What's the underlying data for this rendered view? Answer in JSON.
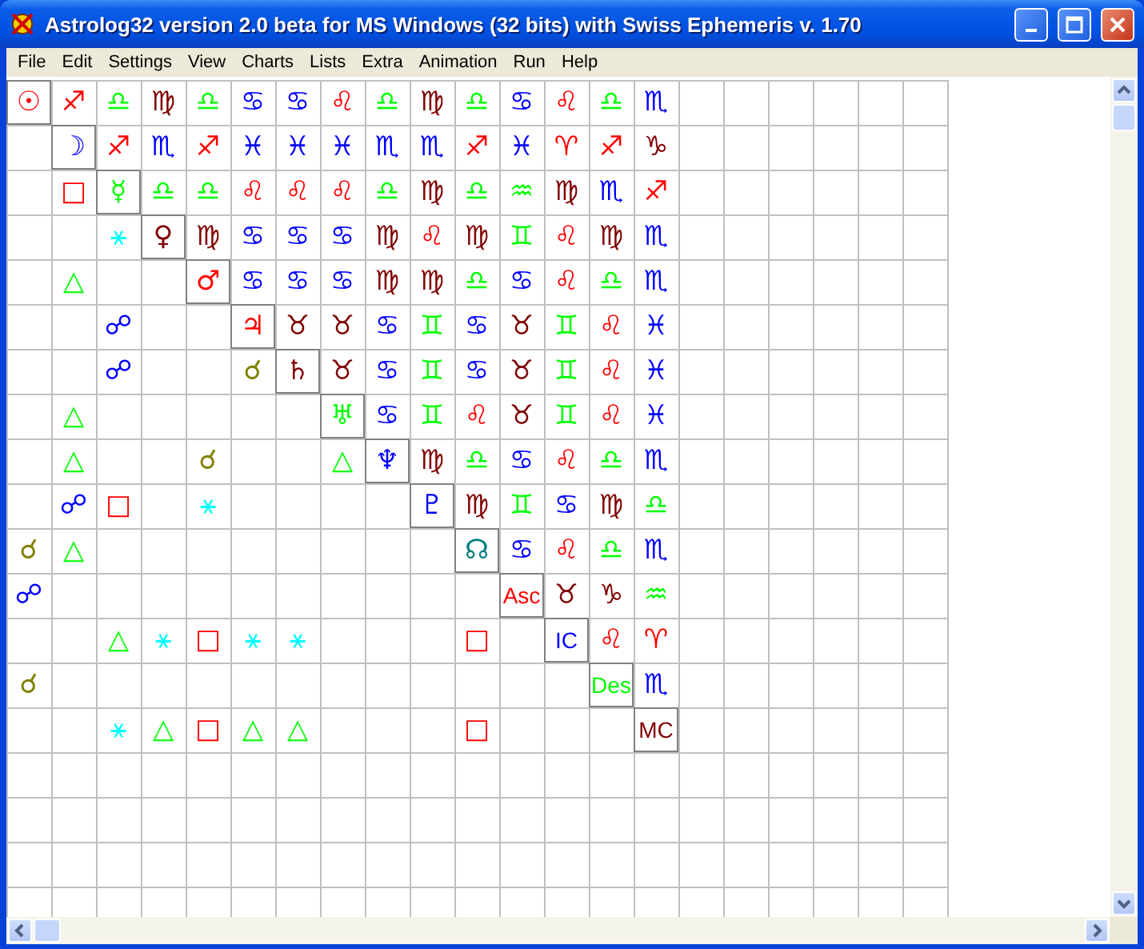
{
  "window": {
    "title": "Astrolog32 version 2.0 beta for MS Windows (32 bits) with Swiss Ephemeris v. 1.70"
  },
  "menu": [
    "File",
    "Edit",
    "Settings",
    "View",
    "Charts",
    "Lists",
    "Extra",
    "Animation",
    "Run",
    "Help"
  ],
  "grid": {
    "rows": [
      [
        {
          "kind": "planet",
          "glyph": "☉",
          "color": "#ff0000"
        },
        {
          "kind": "sign",
          "glyph": "♐",
          "color": "#ff0000"
        },
        {
          "kind": "sign",
          "glyph": "♎",
          "color": "#00ff00"
        },
        {
          "kind": "sign",
          "glyph": "♍",
          "color": "#800000"
        },
        {
          "kind": "sign",
          "glyph": "♎",
          "color": "#00ff00"
        },
        {
          "kind": "sign",
          "glyph": "♋",
          "color": "#0000ff"
        },
        {
          "kind": "sign",
          "glyph": "♋",
          "color": "#0000ff"
        },
        {
          "kind": "sign",
          "glyph": "♌",
          "color": "#ff0000"
        },
        {
          "kind": "sign",
          "glyph": "♎",
          "color": "#00ff00"
        },
        {
          "kind": "sign",
          "glyph": "♍",
          "color": "#800000"
        },
        {
          "kind": "sign",
          "glyph": "♎",
          "color": "#00ff00"
        },
        {
          "kind": "sign",
          "glyph": "♋",
          "color": "#0000ff"
        },
        {
          "kind": "sign",
          "glyph": "♌",
          "color": "#ff0000"
        },
        {
          "kind": "sign",
          "glyph": "♎",
          "color": "#00ff00"
        },
        {
          "kind": "sign",
          "glyph": "♏",
          "color": "#0000ff"
        }
      ],
      [
        null,
        {
          "kind": "planet",
          "glyph": "☽",
          "color": "#0000ff"
        },
        {
          "kind": "sign",
          "glyph": "♐",
          "color": "#ff0000"
        },
        {
          "kind": "sign",
          "glyph": "♏",
          "color": "#0000ff"
        },
        {
          "kind": "sign",
          "glyph": "♐",
          "color": "#ff0000"
        },
        {
          "kind": "sign",
          "glyph": "♓",
          "color": "#0000ff"
        },
        {
          "kind": "sign",
          "glyph": "♓",
          "color": "#0000ff"
        },
        {
          "kind": "sign",
          "glyph": "♓",
          "color": "#0000ff"
        },
        {
          "kind": "sign",
          "glyph": "♏",
          "color": "#0000ff"
        },
        {
          "kind": "sign",
          "glyph": "♏",
          "color": "#0000ff"
        },
        {
          "kind": "sign",
          "glyph": "♐",
          "color": "#ff0000"
        },
        {
          "kind": "sign",
          "glyph": "♓",
          "color": "#0000ff"
        },
        {
          "kind": "sign",
          "glyph": "♈",
          "color": "#ff0000"
        },
        {
          "kind": "sign",
          "glyph": "♐",
          "color": "#ff0000"
        },
        {
          "kind": "sign",
          "glyph": "♑",
          "color": "#800000"
        }
      ],
      [
        null,
        {
          "kind": "aspect",
          "glyph": "□",
          "color": "#ff0000"
        },
        {
          "kind": "planet",
          "glyph": "☿",
          "color": "#00ff00"
        },
        {
          "kind": "sign",
          "glyph": "♎",
          "color": "#00ff00"
        },
        {
          "kind": "sign",
          "glyph": "♎",
          "color": "#00ff00"
        },
        {
          "kind": "sign",
          "glyph": "♌",
          "color": "#ff0000"
        },
        {
          "kind": "sign",
          "glyph": "♌",
          "color": "#ff0000"
        },
        {
          "kind": "sign",
          "glyph": "♌",
          "color": "#ff0000"
        },
        {
          "kind": "sign",
          "glyph": "♎",
          "color": "#00ff00"
        },
        {
          "kind": "sign",
          "glyph": "♍",
          "color": "#800000"
        },
        {
          "kind": "sign",
          "glyph": "♎",
          "color": "#00ff00"
        },
        {
          "kind": "sign",
          "glyph": "♒",
          "color": "#00ff00"
        },
        {
          "kind": "sign",
          "glyph": "♍",
          "color": "#800000"
        },
        {
          "kind": "sign",
          "glyph": "♏",
          "color": "#0000ff"
        },
        {
          "kind": "sign",
          "glyph": "♐",
          "color": "#ff0000"
        }
      ],
      [
        null,
        null,
        {
          "kind": "aspect",
          "glyph": "⚹",
          "color": "#00ffff"
        },
        {
          "kind": "planet",
          "glyph": "♀",
          "color": "#800000"
        },
        {
          "kind": "sign",
          "glyph": "♍",
          "color": "#800000"
        },
        {
          "kind": "sign",
          "glyph": "♋",
          "color": "#0000ff"
        },
        {
          "kind": "sign",
          "glyph": "♋",
          "color": "#0000ff"
        },
        {
          "kind": "sign",
          "glyph": "♋",
          "color": "#0000ff"
        },
        {
          "kind": "sign",
          "glyph": "♍",
          "color": "#800000"
        },
        {
          "kind": "sign",
          "glyph": "♌",
          "color": "#ff0000"
        },
        {
          "kind": "sign",
          "glyph": "♍",
          "color": "#800000"
        },
        {
          "kind": "sign",
          "glyph": "♊",
          "color": "#00ff00"
        },
        {
          "kind": "sign",
          "glyph": "♌",
          "color": "#ff0000"
        },
        {
          "kind": "sign",
          "glyph": "♍",
          "color": "#800000"
        },
        {
          "kind": "sign",
          "glyph": "♏",
          "color": "#0000ff"
        }
      ],
      [
        null,
        {
          "kind": "aspect",
          "glyph": "△",
          "color": "#00ff00"
        },
        null,
        null,
        {
          "kind": "planet",
          "glyph": "♂",
          "color": "#ff0000"
        },
        {
          "kind": "sign",
          "glyph": "♋",
          "color": "#0000ff"
        },
        {
          "kind": "sign",
          "glyph": "♋",
          "color": "#0000ff"
        },
        {
          "kind": "sign",
          "glyph": "♋",
          "color": "#0000ff"
        },
        {
          "kind": "sign",
          "glyph": "♍",
          "color": "#800000"
        },
        {
          "kind": "sign",
          "glyph": "♍",
          "color": "#800000"
        },
        {
          "kind": "sign",
          "glyph": "♎",
          "color": "#00ff00"
        },
        {
          "kind": "sign",
          "glyph": "♋",
          "color": "#0000ff"
        },
        {
          "kind": "sign",
          "glyph": "♌",
          "color": "#ff0000"
        },
        {
          "kind": "sign",
          "glyph": "♎",
          "color": "#00ff00"
        },
        {
          "kind": "sign",
          "glyph": "♏",
          "color": "#0000ff"
        }
      ],
      [
        null,
        null,
        {
          "kind": "aspect",
          "glyph": "☍",
          "color": "#0000ff"
        },
        null,
        null,
        {
          "kind": "planet",
          "glyph": "♃",
          "color": "#ff0000"
        },
        {
          "kind": "sign",
          "glyph": "♉",
          "color": "#800000"
        },
        {
          "kind": "sign",
          "glyph": "♉",
          "color": "#800000"
        },
        {
          "kind": "sign",
          "glyph": "♋",
          "color": "#0000ff"
        },
        {
          "kind": "sign",
          "glyph": "♊",
          "color": "#00ff00"
        },
        {
          "kind": "sign",
          "glyph": "♋",
          "color": "#0000ff"
        },
        {
          "kind": "sign",
          "glyph": "♉",
          "color": "#800000"
        },
        {
          "kind": "sign",
          "glyph": "♊",
          "color": "#00ff00"
        },
        {
          "kind": "sign",
          "glyph": "♌",
          "color": "#ff0000"
        },
        {
          "kind": "sign",
          "glyph": "♓",
          "color": "#0000ff"
        }
      ],
      [
        null,
        null,
        {
          "kind": "aspect",
          "glyph": "☍",
          "color": "#0000ff"
        },
        null,
        null,
        {
          "kind": "aspect",
          "glyph": "☌",
          "color": "#808000"
        },
        {
          "kind": "planet",
          "glyph": "♄",
          "color": "#800000"
        },
        {
          "kind": "sign",
          "glyph": "♉",
          "color": "#800000"
        },
        {
          "kind": "sign",
          "glyph": "♋",
          "color": "#0000ff"
        },
        {
          "kind": "sign",
          "glyph": "♊",
          "color": "#00ff00"
        },
        {
          "kind": "sign",
          "glyph": "♋",
          "color": "#0000ff"
        },
        {
          "kind": "sign",
          "glyph": "♉",
          "color": "#800000"
        },
        {
          "kind": "sign",
          "glyph": "♊",
          "color": "#00ff00"
        },
        {
          "kind": "sign",
          "glyph": "♌",
          "color": "#ff0000"
        },
        {
          "kind": "sign",
          "glyph": "♓",
          "color": "#0000ff"
        }
      ],
      [
        null,
        {
          "kind": "aspect",
          "glyph": "△",
          "color": "#00ff00"
        },
        null,
        null,
        null,
        null,
        null,
        {
          "kind": "planet",
          "glyph": "♅",
          "color": "#00ff00"
        },
        {
          "kind": "sign",
          "glyph": "♋",
          "color": "#0000ff"
        },
        {
          "kind": "sign",
          "glyph": "♊",
          "color": "#00ff00"
        },
        {
          "kind": "sign",
          "glyph": "♌",
          "color": "#ff0000"
        },
        {
          "kind": "sign",
          "glyph": "♉",
          "color": "#800000"
        },
        {
          "kind": "sign",
          "glyph": "♊",
          "color": "#00ff00"
        },
        {
          "kind": "sign",
          "glyph": "♌",
          "color": "#ff0000"
        },
        {
          "kind": "sign",
          "glyph": "♓",
          "color": "#0000ff"
        }
      ],
      [
        null,
        {
          "kind": "aspect",
          "glyph": "△",
          "color": "#00ff00"
        },
        null,
        null,
        {
          "kind": "aspect",
          "glyph": "☌",
          "color": "#808000"
        },
        null,
        null,
        {
          "kind": "aspect",
          "glyph": "△",
          "color": "#00ff00"
        },
        {
          "kind": "planet",
          "glyph": "♆",
          "color": "#0000ff"
        },
        {
          "kind": "sign",
          "glyph": "♍",
          "color": "#800000"
        },
        {
          "kind": "sign",
          "glyph": "♎",
          "color": "#00ff00"
        },
        {
          "kind": "sign",
          "glyph": "♋",
          "color": "#0000ff"
        },
        {
          "kind": "sign",
          "glyph": "♌",
          "color": "#ff0000"
        },
        {
          "kind": "sign",
          "glyph": "♎",
          "color": "#00ff00"
        },
        {
          "kind": "sign",
          "glyph": "♏",
          "color": "#0000ff"
        }
      ],
      [
        null,
        {
          "kind": "aspect",
          "glyph": "☍",
          "color": "#0000ff"
        },
        {
          "kind": "aspect",
          "glyph": "□",
          "color": "#ff0000"
        },
        null,
        {
          "kind": "aspect",
          "glyph": "⚹",
          "color": "#00ffff"
        },
        null,
        null,
        null,
        null,
        {
          "kind": "planet",
          "glyph": "♇",
          "color": "#0000ff"
        },
        {
          "kind": "sign",
          "glyph": "♍",
          "color": "#800000"
        },
        {
          "kind": "sign",
          "glyph": "♊",
          "color": "#00ff00"
        },
        {
          "kind": "sign",
          "glyph": "♋",
          "color": "#0000ff"
        },
        {
          "kind": "sign",
          "glyph": "♍",
          "color": "#800000"
        },
        {
          "kind": "sign",
          "glyph": "♎",
          "color": "#00ff00"
        }
      ],
      [
        {
          "kind": "aspect",
          "glyph": "☌",
          "color": "#808000"
        },
        {
          "kind": "aspect",
          "glyph": "△",
          "color": "#00ff00"
        },
        null,
        null,
        null,
        null,
        null,
        null,
        null,
        null,
        {
          "kind": "planet",
          "glyph": "☊",
          "color": "#008080"
        },
        {
          "kind": "sign",
          "glyph": "♋",
          "color": "#0000ff"
        },
        {
          "kind": "sign",
          "glyph": "♌",
          "color": "#ff0000"
        },
        {
          "kind": "sign",
          "glyph": "♎",
          "color": "#00ff00"
        },
        {
          "kind": "sign",
          "glyph": "♏",
          "color": "#0000ff"
        }
      ],
      [
        {
          "kind": "aspect",
          "glyph": "☍",
          "color": "#0000ff"
        },
        null,
        null,
        null,
        null,
        null,
        null,
        null,
        null,
        null,
        null,
        {
          "kind": "point",
          "glyph": "Asc",
          "color": "#ff0000"
        },
        {
          "kind": "sign",
          "glyph": "♉",
          "color": "#800000"
        },
        {
          "kind": "sign",
          "glyph": "♑",
          "color": "#800000"
        },
        {
          "kind": "sign",
          "glyph": "♒",
          "color": "#00ff00"
        }
      ],
      [
        null,
        null,
        {
          "kind": "aspect",
          "glyph": "△",
          "color": "#00ff00"
        },
        {
          "kind": "aspect",
          "glyph": "⚹",
          "color": "#00ffff"
        },
        {
          "kind": "aspect",
          "glyph": "□",
          "color": "#ff0000"
        },
        {
          "kind": "aspect",
          "glyph": "⚹",
          "color": "#00ffff"
        },
        {
          "kind": "aspect",
          "glyph": "⚹",
          "color": "#00ffff"
        },
        null,
        null,
        null,
        {
          "kind": "aspect",
          "glyph": "□",
          "color": "#ff0000"
        },
        null,
        {
          "kind": "point",
          "glyph": "IC",
          "color": "#0000ff"
        },
        {
          "kind": "sign",
          "glyph": "♌",
          "color": "#ff0000"
        },
        {
          "kind": "sign",
          "glyph": "♈",
          "color": "#ff0000"
        }
      ],
      [
        {
          "kind": "aspect",
          "glyph": "☌",
          "color": "#808000"
        },
        null,
        null,
        null,
        null,
        null,
        null,
        null,
        null,
        null,
        null,
        null,
        null,
        {
          "kind": "point",
          "glyph": "Des",
          "color": "#00ff00"
        },
        {
          "kind": "sign",
          "glyph": "♏",
          "color": "#0000ff"
        }
      ],
      [
        null,
        null,
        {
          "kind": "aspect",
          "glyph": "⚹",
          "color": "#00ffff"
        },
        {
          "kind": "aspect",
          "glyph": "△",
          "color": "#00ff00"
        },
        {
          "kind": "aspect",
          "glyph": "□",
          "color": "#ff0000"
        },
        {
          "kind": "aspect",
          "glyph": "△",
          "color": "#00ff00"
        },
        {
          "kind": "aspect",
          "glyph": "△",
          "color": "#00ff00"
        },
        null,
        null,
        null,
        {
          "kind": "aspect",
          "glyph": "□",
          "color": "#ff0000"
        },
        null,
        null,
        null,
        {
          "kind": "point",
          "glyph": "MC",
          "color": "#800000"
        }
      ]
    ]
  }
}
